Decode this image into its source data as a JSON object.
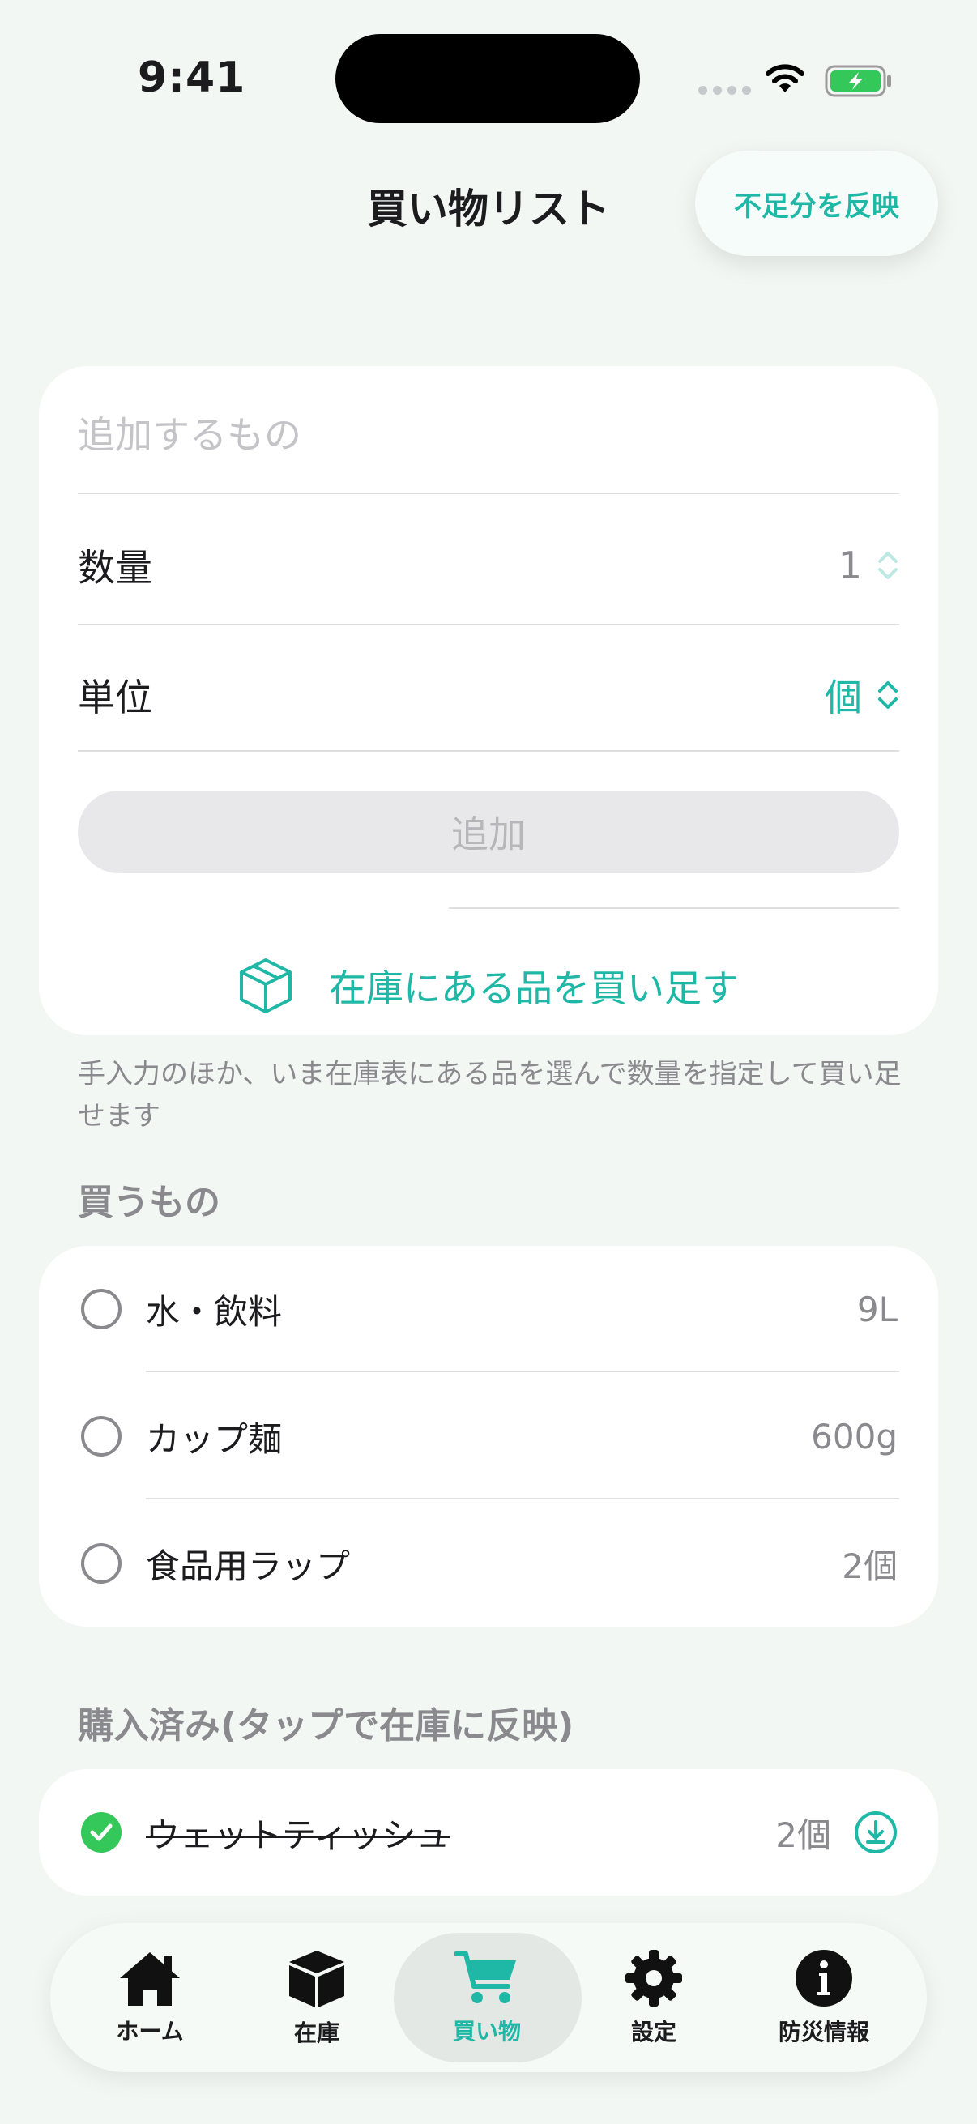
{
  "status": {
    "time": "9:41"
  },
  "nav": {
    "title": "買い物リスト",
    "reflect_button": "不足分を反映"
  },
  "form": {
    "item_placeholder": "追加するもの",
    "quantity_label": "数量",
    "quantity_value": "1",
    "unit_label": "単位",
    "unit_value": "個",
    "add_button": "追加",
    "restock_button": "在庫にある品を買い足す"
  },
  "hint": "手入力のほか、いま在庫表にある品を選んで数量を指定して買い足せます",
  "to_buy": {
    "header": "買うもの",
    "items": [
      {
        "name": "水・飲料",
        "qty": "9L"
      },
      {
        "name": "カップ麺",
        "qty": "600g"
      },
      {
        "name": "食品用ラップ",
        "qty": "2個"
      }
    ]
  },
  "purchased": {
    "header": "購入済み(タップで在庫に反映)",
    "items": [
      {
        "name": "ウェットティッシュ",
        "qty": "2個"
      }
    ]
  },
  "tabs": [
    {
      "label": "ホーム",
      "icon": "house-icon"
    },
    {
      "label": "在庫",
      "icon": "box-icon"
    },
    {
      "label": "買い物",
      "icon": "cart-icon",
      "active": true
    },
    {
      "label": "設定",
      "icon": "gear-icon"
    },
    {
      "label": "防災情報",
      "icon": "info-icon"
    }
  ],
  "colors": {
    "accent": "#1fb8a6",
    "check": "#34c759",
    "background": "#f2f7f4"
  }
}
